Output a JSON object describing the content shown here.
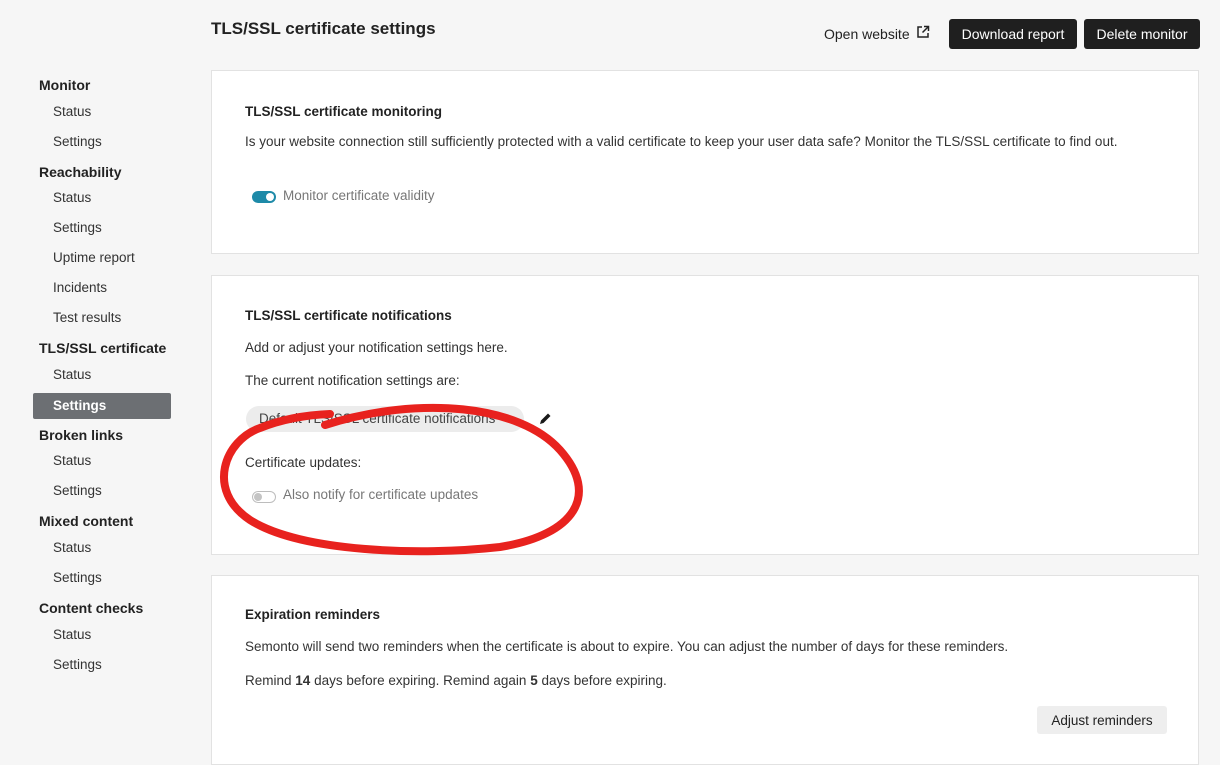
{
  "header": {
    "title": "TLS/SSL certificate settings",
    "open_website": "Open website",
    "download_report": "Download report",
    "delete_monitor": "Delete monitor"
  },
  "sidebar": {
    "groups": [
      {
        "label": "Monitor",
        "items": [
          "Status",
          "Settings"
        ]
      },
      {
        "label": "Reachability",
        "items": [
          "Status",
          "Settings",
          "Uptime report",
          "Incidents",
          "Test results"
        ]
      },
      {
        "label": "TLS/SSL certificate",
        "items": [
          "Status",
          "Settings"
        ]
      },
      {
        "label": "Broken links",
        "items": [
          "Status",
          "Settings"
        ]
      },
      {
        "label": "Mixed content",
        "items": [
          "Status",
          "Settings"
        ]
      },
      {
        "label": "Content checks",
        "items": [
          "Status",
          "Settings"
        ]
      }
    ],
    "active": "TLS/SSL certificate > Settings"
  },
  "monitoring": {
    "title": "TLS/SSL certificate monitoring",
    "description": "Is your website connection still sufficiently protected with a valid certificate to keep your user data safe? Monitor the TLS/SSL certificate to find out.",
    "toggle_label": "Monitor certificate validity",
    "toggle_on": true
  },
  "notifications": {
    "title": "TLS/SSL certificate notifications",
    "line1": "Add or adjust your notification settings here.",
    "line2": "The current notification settings are:",
    "current_setting": "Default TLS/SSL certificate notifications",
    "updates_label": "Certificate updates:",
    "updates_toggle_label": "Also notify for certificate updates",
    "updates_toggle_on": false
  },
  "reminders": {
    "title": "Expiration reminders",
    "description": "Semonto will send two reminders when the certificate is about to expire. You can adjust the number of days for these reminders.",
    "remind_prefix": "Remind ",
    "first_days": "14",
    "remind_middle": " days before expiring. Remind again ",
    "second_days": "5",
    "remind_suffix": " days before expiring.",
    "adjust_button": "Adjust reminders"
  },
  "colors": {
    "accent": "#1e8aa8",
    "annotation": "#e8221e",
    "active_nav": "#6c6f73",
    "button_dark": "#1f1f1f"
  }
}
